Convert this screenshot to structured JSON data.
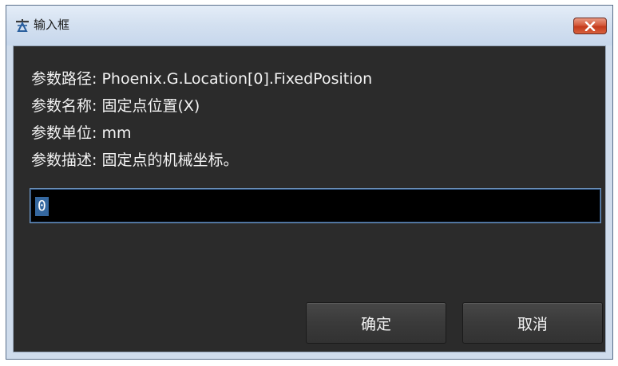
{
  "window": {
    "title": "输入框",
    "icon": "app-tool-icon",
    "close_icon": "close-icon"
  },
  "info": {
    "lines": [
      "参数路径: Phoenix.G.Location[0].FixedPosition",
      "参数名称: 固定点位置(X)",
      "参数单位: mm",
      "参数描述: 固定点的机械坐标。"
    ]
  },
  "input": {
    "value": "0"
  },
  "buttons": {
    "ok_label": "确定",
    "cancel_label": "取消"
  },
  "colors": {
    "client_bg": "#2b2b2b",
    "input_bg": "#000000",
    "selection": "#3568a0",
    "close_button": "#c43a1c"
  }
}
